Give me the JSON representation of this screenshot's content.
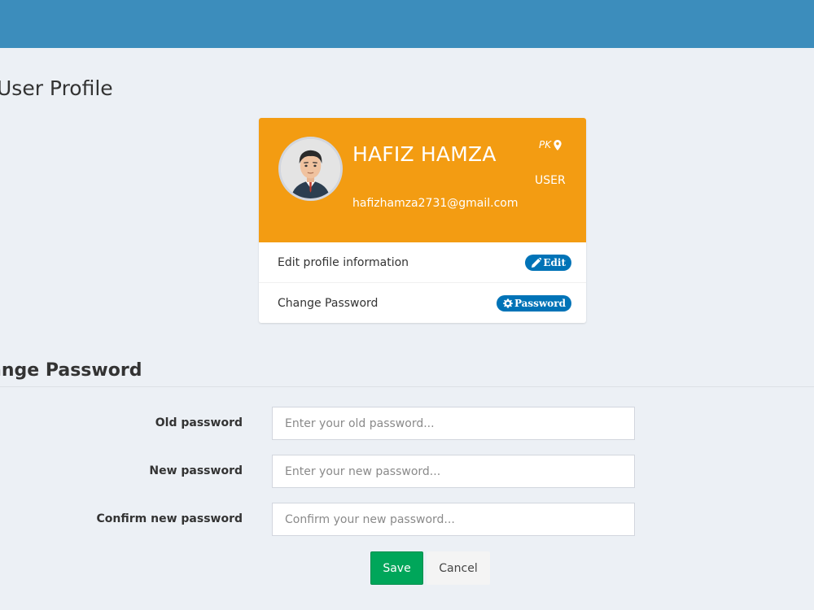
{
  "page": {
    "title": "User Profile",
    "accent_color": "#3c8dbc",
    "background_color": "#ecf0f5"
  },
  "profile": {
    "name": "HAFIZ HAMZA",
    "email": "hafizhamza2731@gmail.com",
    "country": "PK",
    "role": "USER",
    "header_color": "#f39c12",
    "avatar_icon": "user-avatar-icon",
    "location_icon": "map-marker-icon",
    "rows": [
      {
        "label": "Edit profile information",
        "button_label": "Edit",
        "button_icon": "pencil-icon",
        "button_color": "#0073b7"
      },
      {
        "label": "Change Password",
        "button_label": "Password",
        "button_icon": "gear-icon",
        "button_color": "#0073b7"
      }
    ]
  },
  "change_password": {
    "title": "ange Password",
    "fields": [
      {
        "label": "Old password",
        "value": "",
        "placeholder": "Enter your old password..."
      },
      {
        "label": "New password",
        "value": "",
        "placeholder": "Enter your new password..."
      },
      {
        "label": "Confirm new password",
        "value": "",
        "placeholder": "Confirm your new password..."
      }
    ],
    "save_label": "Save",
    "save_color": "#00a65a",
    "cancel_label": "Cancel"
  }
}
